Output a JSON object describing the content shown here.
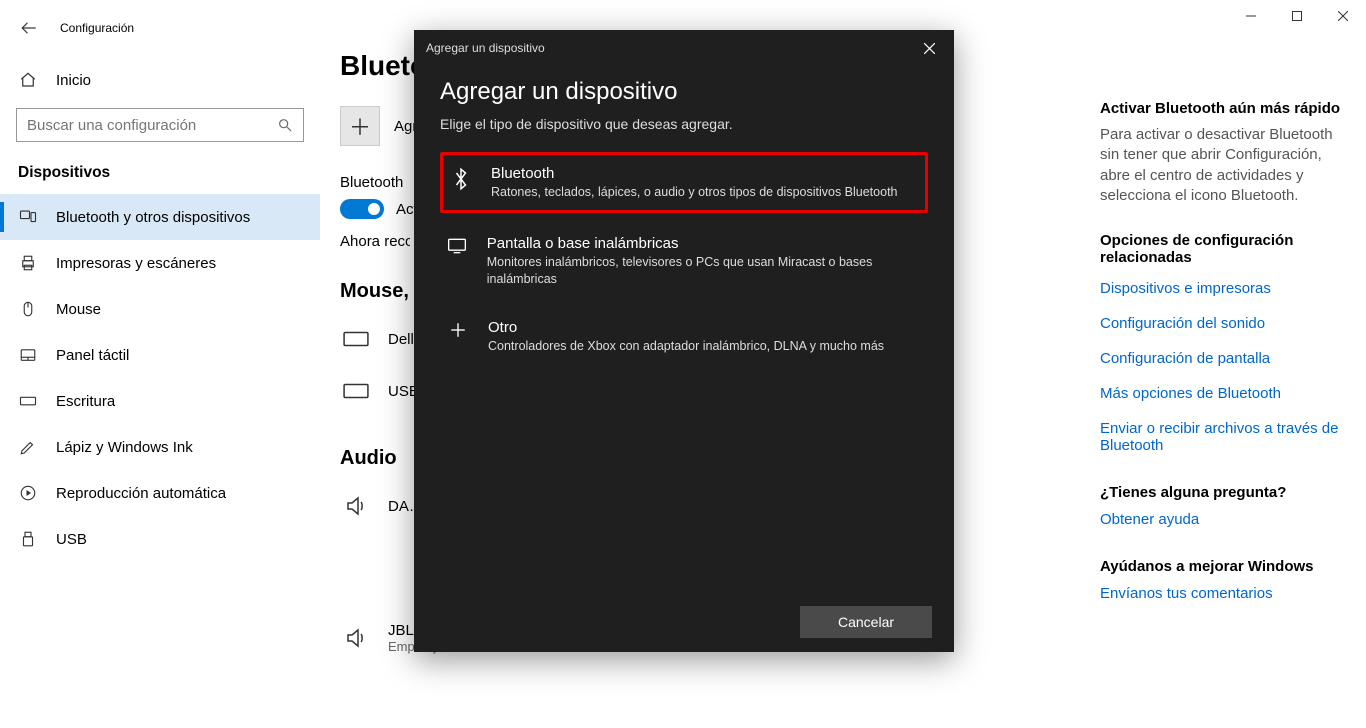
{
  "window": {
    "app_title": "Configuración",
    "home_label": "Inicio",
    "search_placeholder": "Buscar una configuración",
    "section_title": "Dispositivos"
  },
  "nav": [
    {
      "label": "Bluetooth y otros dispositivos"
    },
    {
      "label": "Impresoras y escáneres"
    },
    {
      "label": "Mouse"
    },
    {
      "label": "Panel táctil"
    },
    {
      "label": "Escritura"
    },
    {
      "label": "Lápiz y Windows Ink"
    },
    {
      "label": "Reproducción automática"
    },
    {
      "label": "USB"
    }
  ],
  "main": {
    "heading": "Bluetooth y otros dispositivos",
    "add_label": "Agregar Bluetooth u otro dispositivo",
    "bt_label": "Bluetooth",
    "toggle_state": "Activado",
    "discoverable": "Ahora reconocible como …",
    "group_mouse": "Mouse, teclado y lápiz",
    "dev_dell": "Dell",
    "dev_usb": "USB Receiver",
    "group_audio": "Audio",
    "dev_da": "DA…",
    "dev_jbl": "JBL Xtreme",
    "dev_jbl_status": "Emparejado"
  },
  "right": {
    "h1": "Activar Bluetooth aún más rápido",
    "p1": "Para activar o desactivar Bluetooth sin tener que abrir Configuración, abre el centro de actividades y selecciona el icono Bluetooth.",
    "h2": "Opciones de configuración relacionadas",
    "links": [
      "Dispositivos e impresoras",
      "Configuración del sonido",
      "Configuración de pantalla",
      "Más opciones de Bluetooth",
      "Enviar o recibir archivos a través de Bluetooth"
    ],
    "h3": "¿Tienes alguna pregunta?",
    "help": "Obtener ayuda",
    "h4": "Ayúdanos a mejorar Windows",
    "feedback": "Envíanos tus comentarios"
  },
  "modal": {
    "titlebar": "Agregar un dispositivo",
    "heading": "Agregar un dispositivo",
    "subtitle": "Elige el tipo de dispositivo que deseas agregar.",
    "options": [
      {
        "name": "Bluetooth",
        "desc": "Ratones, teclados, lápices, o audio y otros tipos de dispositivos Bluetooth"
      },
      {
        "name": "Pantalla o base inalámbricas",
        "desc": "Monitores inalámbricos, televisores o PCs que usan Miracast o bases inalámbricas"
      },
      {
        "name": "Otro",
        "desc": "Controladores de Xbox con adaptador inalámbrico, DLNA y mucho más"
      }
    ],
    "cancel": "Cancelar"
  }
}
